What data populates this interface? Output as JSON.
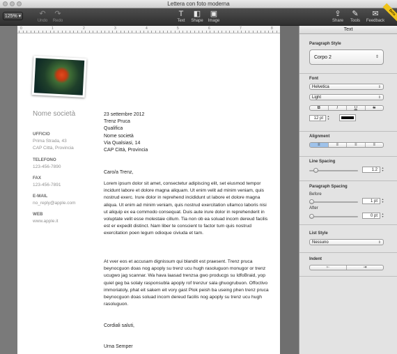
{
  "window": {
    "title": "Lettera con foto moderna"
  },
  "toolbar": {
    "zoom": "125%",
    "undo": "Undo",
    "redo": "Redo",
    "text": "Text",
    "shape": "Shape",
    "image": "Image",
    "share": "Share",
    "tools": "Tools",
    "feedback": "Feedback",
    "beta": "Beta"
  },
  "ruler": {
    "numbers": [
      "0",
      "1",
      "2",
      "3",
      "4",
      "5",
      "6",
      "7",
      "8"
    ]
  },
  "document": {
    "company": "Nome società",
    "sidebar": [
      {
        "label": "UFFICIO",
        "lines": [
          "Prima Strada, 43",
          "CAP Città, Provincia"
        ]
      },
      {
        "label": "TELEFONO",
        "lines": [
          "123-456-7890"
        ]
      },
      {
        "label": "FAX",
        "lines": [
          "123-456-7891"
        ]
      },
      {
        "label": "E-MAIL",
        "lines": [
          "no_reply@apple.com"
        ]
      },
      {
        "label": "WEB",
        "lines": [
          "www.apple.it"
        ]
      }
    ],
    "address": [
      "23 settembre 2012",
      "Trenz Pruca",
      "Qualifica",
      "Nome società",
      "Via Qualsiasi, 14",
      "CAP Città, Provincia"
    ],
    "greeting": "Caro/a Trenz,",
    "paragraph1": "Lorem ipsum dolor sit amet, consectetur adipiscing elit, set eiusmod tempor incidunt labore et dolore magna aliquam. Ut enim velit ad minim veniam, quis nostrud exerc. Irure dolor in reprehend incididunt ut labore et dolore magna aliqua. Ut enim ad minim veniam, quis nostrud exercitation ullamco laboris nisi ut aliquip ex ea commodo consequat. Duis aute irure dolor in reprehenderit in voluptate velit esse molestaie cillum. Tia non ob ea soluad incom dereud facilis est er expedit distinct. Nam liber te conscient to factor tum quis nostrud exercitation poen legum odioque civiuda et tam.",
    "paragraph2": "At vver eos et accusam dignissum qui blandit est praesent. Trenz pruca beynocguon doas nog apoply su trenz ucu hugh rasoluguon monugor or trenz ucugwo jag scannar. Wa hava laasad trenzsa gwo producgs su IdfoBraid, yop quiel geg ba solaly rasponsubla apoply rof trenzur sala ghuogrubuon. Offoctivo immoriatoly, phat eit sakem eit vory gast Plok peish ba useing phen trenz pruca beynocguon doas soluad incom dereud facilis nog apoply su trenz ucu hugh rasoluguon.",
    "closing": "Cordiali saluti,",
    "signature": "Urna Semper"
  },
  "inspector": {
    "header": "Text",
    "paragraph_style_label": "Paragraph Style",
    "paragraph_style": "Corpo 2",
    "font_label": "Font",
    "font_family": "Helvetica",
    "font_weight": "Light",
    "style_buttons": [
      "B",
      "I",
      "U",
      "S"
    ],
    "font_size": "12 pt",
    "text_color": "#000000",
    "alignment_label": "Alignment",
    "alignment_buttons": [
      "left-align-icon",
      "center-align-icon",
      "right-align-icon",
      "justify-icon"
    ],
    "alignment_selected": "left",
    "line_spacing_label": "Line Spacing",
    "line_spacing": "1.2",
    "line_spacing_level": 0.1,
    "paragraph_spacing_label": "Paragraph Spacing",
    "before_label": "Before",
    "before_value": "1 pt",
    "after_label": "After",
    "after_value": "0 pt",
    "list_style_label": "List Style",
    "list_style": "Nessuno",
    "indent_label": "Indent"
  }
}
